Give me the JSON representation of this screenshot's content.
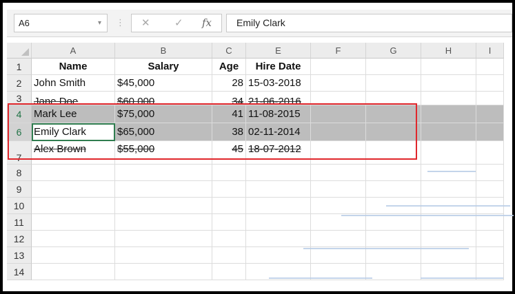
{
  "name_box": {
    "value": "A6",
    "caret": "▾"
  },
  "formula_bar": {
    "separator": "⋮",
    "cancel_icon": "✕",
    "enter_icon": "✓",
    "fx_label": "fx",
    "content": "Emily Clark"
  },
  "columns": [
    "A",
    "B",
    "C",
    "E",
    "F",
    "G",
    "H",
    "I"
  ],
  "rows": [
    {
      "num": "1",
      "cells": [
        "Name",
        "Salary",
        "Age",
        "Hire Date"
      ],
      "header": true
    },
    {
      "num": "2",
      "cells": [
        "John Smith",
        "$45,000",
        "28",
        "15-03-2018"
      ]
    },
    {
      "num": "3",
      "cells": [
        "Jane Doe",
        "$60,000",
        "34",
        "21-06-2016"
      ]
    },
    {
      "num": "4",
      "cells": [
        "Mark Lee",
        "$75,000",
        "41",
        "11-08-2015"
      ],
      "selected": true
    },
    {
      "num": "6",
      "cells": [
        "Emily Clark",
        "$65,000",
        "38",
        "02-11-2014"
      ],
      "selected": true
    },
    {
      "num": "7",
      "cells": [
        "Alex Brown",
        "$55,000",
        "45",
        "18-07-2012"
      ]
    },
    {
      "num": "8",
      "cells": []
    },
    {
      "num": "9",
      "cells": []
    },
    {
      "num": "10",
      "cells": []
    },
    {
      "num": "11",
      "cells": []
    },
    {
      "num": "12",
      "cells": []
    },
    {
      "num": "13",
      "cells": []
    },
    {
      "num": "14",
      "cells": []
    }
  ],
  "highlight_color": "#e0262b"
}
